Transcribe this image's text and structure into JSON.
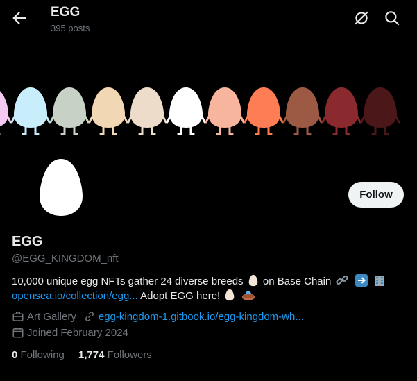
{
  "header": {
    "title": "EGG",
    "posts_count": "395 posts",
    "icons": [
      "back-arrow-icon",
      "grok-icon",
      "search-icon"
    ]
  },
  "banner": {
    "egg_colors": [
      "#f6c9f2",
      "#c9eefb",
      "#c7d1c6",
      "#f1d7b3",
      "#ecdcc9",
      "#ffffff",
      "#f8b59d",
      "#ff7d55",
      "#9c5a45",
      "#8a2a2e",
      "#4b1718"
    ]
  },
  "profile": {
    "name": "EGG",
    "handle": "@EGG_KINGDOM_nft",
    "follow_label": "Follow",
    "bio_text_1": "10,000 unique egg NFTs gather 24 diverse breeds",
    "bio_text_2": "on Base Chain",
    "bio_link": "opensea.io/collection/egg...",
    "bio_text_3": "Adopt EGG here!",
    "category": "Art Gallery",
    "website": "egg-kingdom-1.gitbook.io/egg-kingdom-wh...",
    "joined": "Joined February 2024",
    "following_count": "0",
    "following_label": "Following",
    "followers_count": "1,774",
    "followers_label": "Followers"
  },
  "colors": {
    "accent": "#1d9bf0",
    "muted": "#71767b",
    "text": "#e7e9ea"
  }
}
